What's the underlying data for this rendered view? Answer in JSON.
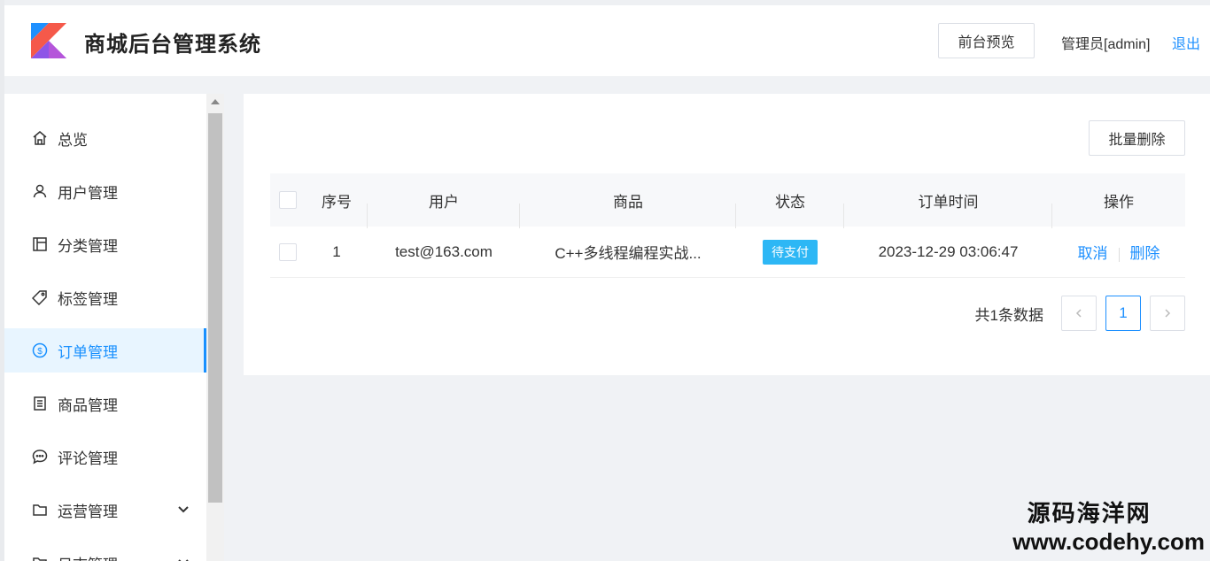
{
  "header": {
    "title": "商城后台管理系统",
    "preview_label": "前台预览",
    "admin_label": "管理员[admin]",
    "logout_label": "退出",
    "logo_colors": [
      "#1e90ff",
      "#f5594a",
      "#8e55e7"
    ]
  },
  "sidebar": {
    "items": [
      {
        "label": "总览",
        "icon": "home-icon"
      },
      {
        "label": "用户管理",
        "icon": "user-icon"
      },
      {
        "label": "分类管理",
        "icon": "category-icon"
      },
      {
        "label": "标签管理",
        "icon": "tag-icon"
      },
      {
        "label": "订单管理",
        "icon": "dollar-icon",
        "active": true
      },
      {
        "label": "商品管理",
        "icon": "product-icon"
      },
      {
        "label": "评论管理",
        "icon": "comment-icon"
      },
      {
        "label": "运营管理",
        "icon": "folder-icon",
        "expandable": true
      },
      {
        "label": "日志管理",
        "icon": "folder-icon",
        "expandable": true
      }
    ]
  },
  "main": {
    "batch_delete_label": "批量删除",
    "table": {
      "columns": [
        "序号",
        "用户",
        "商品",
        "状态",
        "订单时间",
        "操作"
      ],
      "rows": [
        {
          "index": "1",
          "user": "test@163.com",
          "product": "C++多线程编程实战...",
          "status": "待支付",
          "time": "2023-12-29 03:06:47",
          "actions": [
            "取消",
            "删除"
          ]
        }
      ]
    },
    "pagination": {
      "total_label": "共1条数据",
      "current_page": "1"
    }
  },
  "watermark": {
    "cn": "源码海洋网",
    "url": "www.codehy.com"
  },
  "colors": {
    "accent": "#1e90ff",
    "status_badge": "#2db7f5",
    "active_bg": "#e8f5ff"
  }
}
